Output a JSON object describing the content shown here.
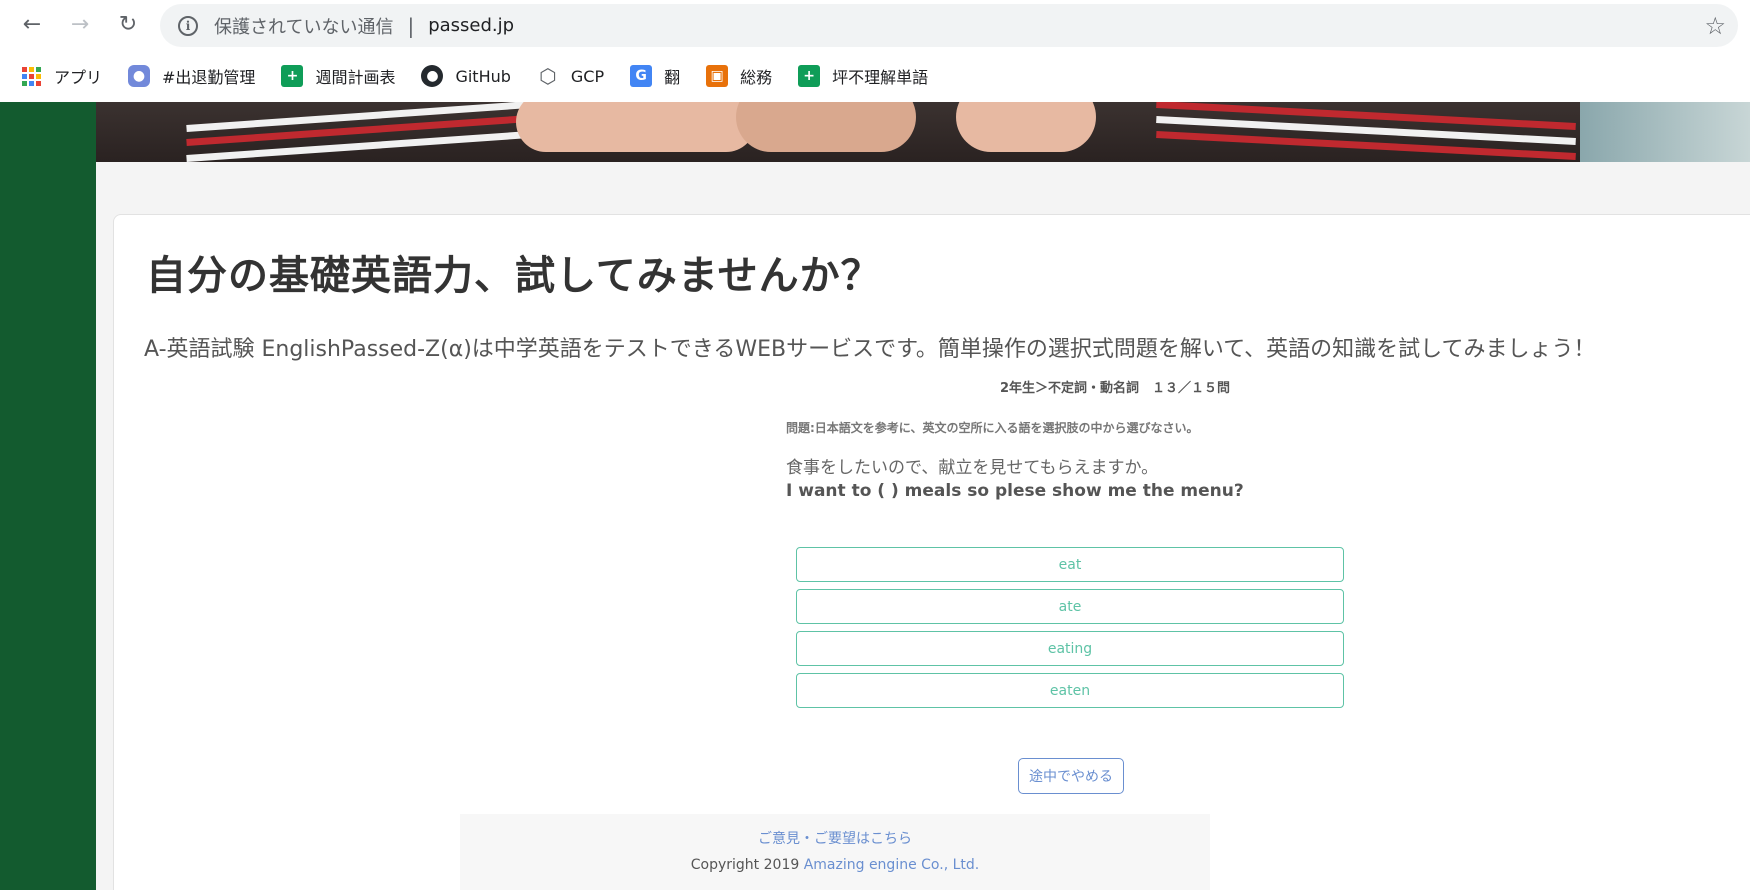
{
  "browser": {
    "security_label": "保護されていない通信",
    "url": "passed.jp",
    "bookmarks": [
      {
        "label": "アプリ",
        "icon": "apps-icon"
      },
      {
        "label": "#出退勤管理",
        "icon": "discord-icon",
        "color": "#7289da"
      },
      {
        "label": "週間計画表",
        "icon": "sheets-icon",
        "color": "#0f9d58"
      },
      {
        "label": "GitHub",
        "icon": "github-icon",
        "color": "#24292e"
      },
      {
        "label": "GCP",
        "icon": "gcp-icon",
        "color": "#5f6368"
      },
      {
        "label": "翻",
        "icon": "translate-icon",
        "color": "#4285f4"
      },
      {
        "label": "総務",
        "icon": "forms-icon",
        "color": "#e8710a"
      },
      {
        "label": "坪不理解単語",
        "icon": "sheets-icon",
        "color": "#0f9d58"
      }
    ]
  },
  "page": {
    "title": "自分の基礎英語力、試してみませんか？",
    "lead": "A-英語試験 EnglishPassed-Z(α)は中学英語をテストできるWEBサービスです。簡単操作の選択式問題を解いて、英語の知識を試してみましょう！",
    "quiz": {
      "progress": "2年生＞不定詞・動名詞　１３／１５問",
      "instruction": "問題:日本語文を参考に、英文の空所に入る語を選択肢の中から選びなさい。",
      "japanese": "食事をしたいので、献立を見せてもらえますか。",
      "english": "I want to ( ) meals so plese show me the menu?",
      "choices": [
        "eat",
        "ate",
        "eating",
        "eaten"
      ],
      "quit_label": "途中でやめる"
    },
    "footer": {
      "feedback": "ご意見・ご要望はこちら",
      "copyright_prefix": "Copyright 2019 ",
      "company": "Amazing engine Co., Ltd."
    }
  },
  "colors": {
    "accent_green": "#5ec3a6",
    "link_blue": "#6a8fd0",
    "rail_green": "#135b2f"
  }
}
